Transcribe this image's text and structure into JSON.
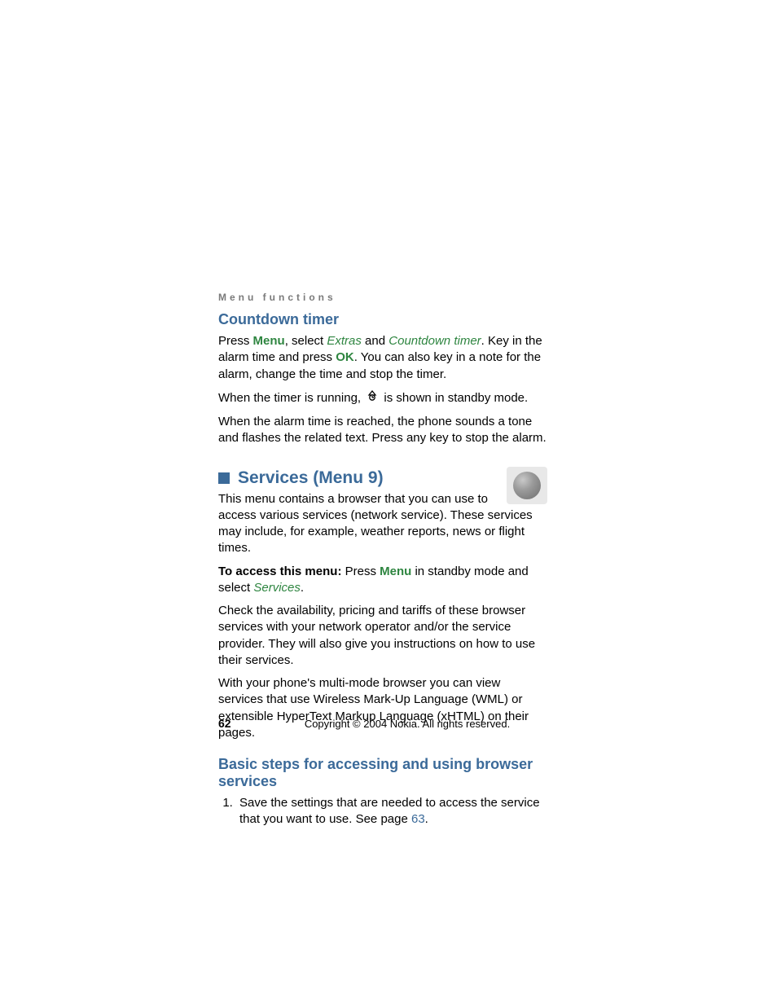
{
  "headerLabel": "Menu functions",
  "section1": {
    "title": "Countdown timer",
    "p1_a": "Press ",
    "p1_menu": "Menu",
    "p1_b": ", select ",
    "p1_extras": "Extras",
    "p1_c": " and ",
    "p1_ct": "Countdown timer",
    "p1_d": ". Key in the alarm time and press ",
    "p1_ok": "OK",
    "p1_e": ". You can also key in a note for the alarm, change the time and stop the timer.",
    "p2_a": "When the timer is running, ",
    "p2_b": " is shown in standby mode.",
    "p3": "When the alarm time is reached, the phone sounds a tone and flashes the related text. Press any key to stop the alarm."
  },
  "section2": {
    "title": "Services (Menu 9)",
    "p1": "This menu contains a browser that you can use to access various services (network service). These services may include, for example, weather reports, news or flight times.",
    "p2_a": "To access this menu:",
    "p2_b": " Press ",
    "p2_menu": "Menu",
    "p2_c": " in standby mode and select ",
    "p2_services": "Services",
    "p2_d": ".",
    "p3": "Check the availability, pricing and tariffs of these browser services with your network operator and/or the service provider. They will also give you instructions on how to use their services.",
    "p4": "With your phone's multi-mode browser you can view services that use Wireless Mark-Up Language (WML) or extensible HyperText Markup Language (xHTML) on their pages."
  },
  "section3": {
    "title": "Basic steps for accessing and using browser services",
    "li1_a": "Save the settings that are needed to access the service that you want to use. See page ",
    "li1_link": "63",
    "li1_b": "."
  },
  "footer": {
    "pageNum": "62",
    "copyright": "Copyright © 2004 Nokia. All rights reserved."
  }
}
